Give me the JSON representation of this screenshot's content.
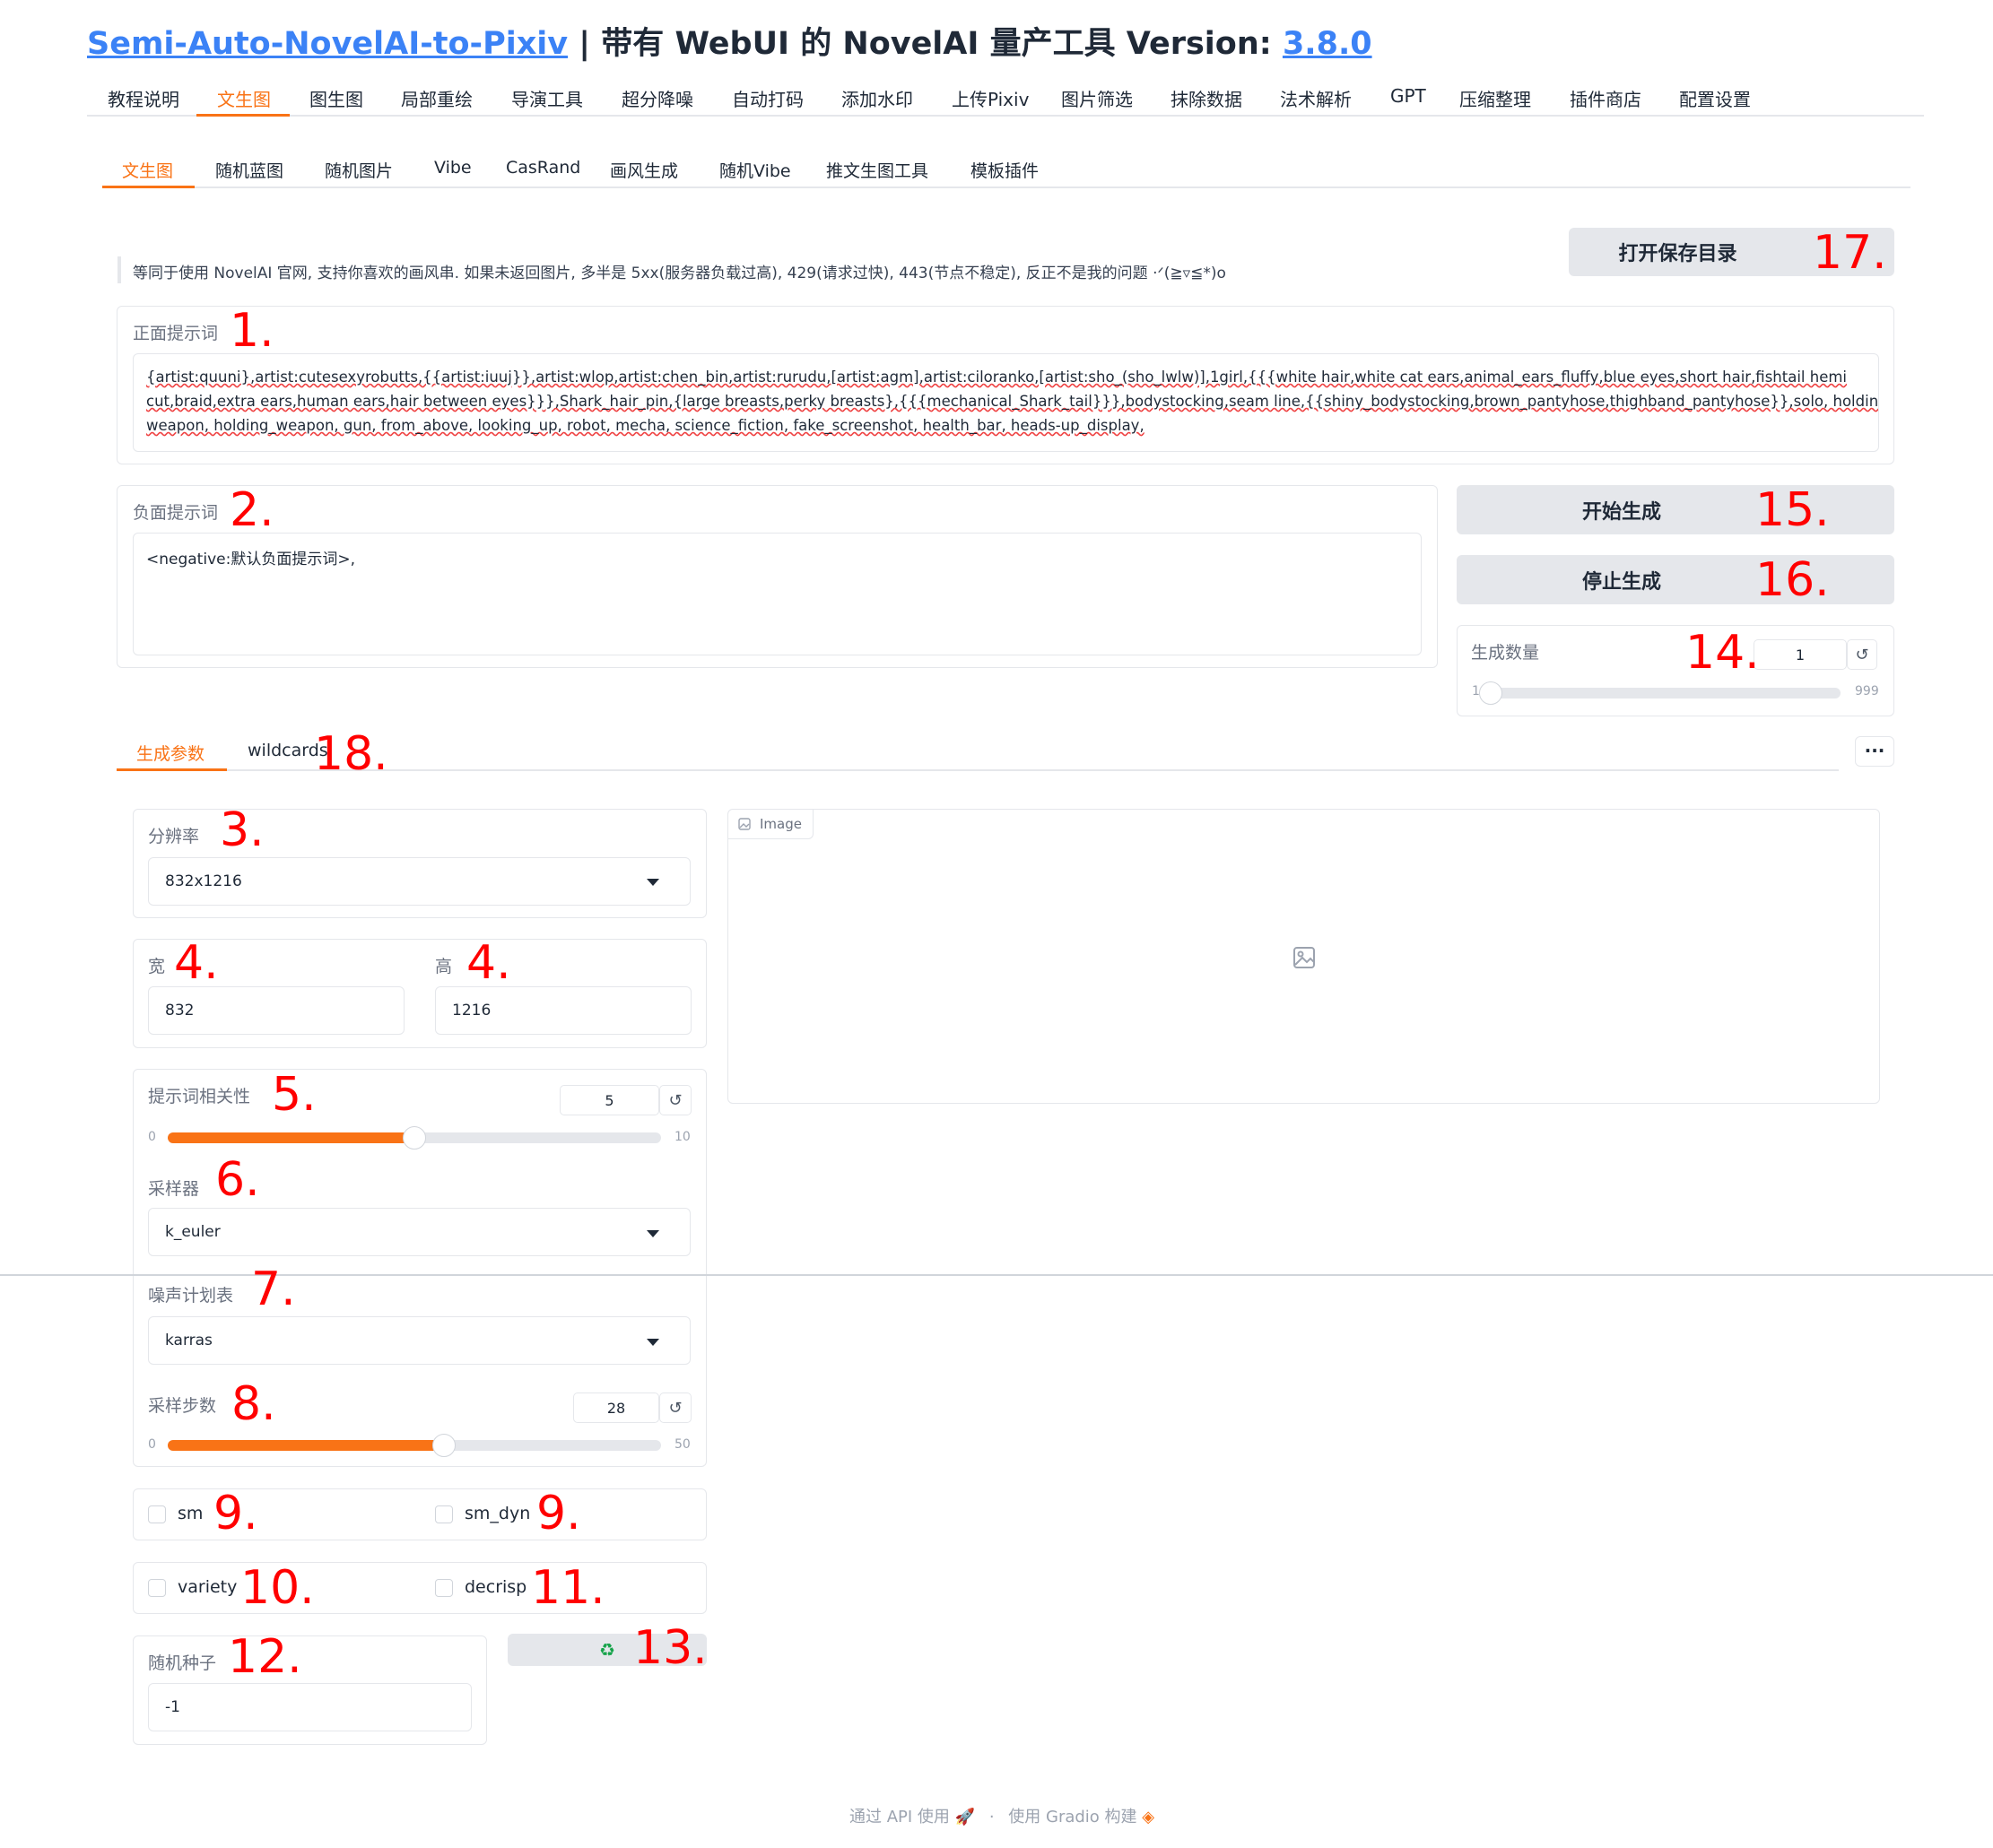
{
  "header": {
    "title_link": "Semi-Auto-NovelAI-to-Pixiv",
    "separator": " | ",
    "subtitle": "带有 WebUI 的 NovelAI 量产工具 Version: ",
    "version": "3.8.0"
  },
  "main_tabs": [
    "教程说明",
    "文生图",
    "图生图",
    "局部重绘",
    "导演工具",
    "超分降噪",
    "自动打码",
    "添加水印",
    "上传Pixiv",
    "图片筛选",
    "抹除数据",
    "法术解析",
    "GPT",
    "压缩整理",
    "插件商店",
    "配置设置"
  ],
  "sub_tabs": [
    "文生图",
    "随机蓝图",
    "随机图片",
    "Vibe",
    "CasRand",
    "画风生成",
    "随机Vibe",
    "推文生图工具",
    "模板插件"
  ],
  "info_text": "等同于使用 NovelAI 官网, 支持你喜欢的画风串. 如果未返回图片, 多半是 5xx(服务器负载过高), 429(请求过快), 443(节点不稳定), 反正不是我的问题 ·ᐟ(≧▿≦*)o",
  "open_folder_button": "打开保存目录",
  "positive": {
    "label": "正面提示词",
    "lines": [
      "{artist:quuni},artist:cutesexyrobutts,{{artist:iuuj}},artist:wlop,artist:chen_bin,artist:rurudu,[artist:agm],artist:ciloranko,[artist:sho_(sho_lwlw)],1girl,{{{white hair,white cat ears,animal_ears_fluffy,blue eyes,short hair,fishtail hemi",
      "cut,braid,extra ears,human ears,hair between eyes}}},Shark_hair_pin,{large breasts,perky breasts},{{{mechanical_Shark_tail}}},bodystocking,seam line,{{shiny_bodystocking,brown_pantyhose,thighband_pantyhose}},solo, holding,",
      "weapon, holding_weapon, gun, from_above, looking_up, robot, mecha, science_fiction, fake_screenshot, health_bar, heads-up_display,"
    ]
  },
  "negative": {
    "label": "负面提示词",
    "value": "<negative:默认负面提示词>,"
  },
  "start_button": "开始生成",
  "stop_button": "停止生成",
  "batch": {
    "label": "生成数量",
    "value": "1",
    "min": "1",
    "max": "999",
    "fraction": 0.0
  },
  "param_tabs": [
    "生成参数",
    "wildcards"
  ],
  "more_button": "···",
  "resolution": {
    "label": "分辨率",
    "value": "832x1216"
  },
  "width": {
    "label": "宽",
    "value": "832"
  },
  "height": {
    "label": "高",
    "value": "1216"
  },
  "cfg": {
    "label": "提示词相关性",
    "value": "5",
    "min": "0",
    "max": "10",
    "fraction": 0.5
  },
  "sampler": {
    "label": "采样器",
    "value": "k_euler"
  },
  "scheduler": {
    "label": "噪声计划表",
    "value": "karras"
  },
  "steps": {
    "label": "采样步数",
    "value": "28",
    "min": "0",
    "max": "50",
    "fraction": 0.56
  },
  "checkboxes": {
    "sm": "sm",
    "sm_dyn": "sm_dyn",
    "variety": "variety",
    "decrisp": "decrisp"
  },
  "seed": {
    "label": "随机种子",
    "value": "-1"
  },
  "recycle_icon": "♻",
  "image_panel": {
    "label": "Image"
  },
  "footer": {
    "api": "通过 API 使用",
    "dot": "·",
    "built": "使用 Gradio 构建"
  },
  "annotations": {
    "a1": "1.",
    "a2": "2.",
    "a3": "3.",
    "a4a": "4.",
    "a4b": "4.",
    "a5": "5.",
    "a6": "6.",
    "a7": "7.",
    "a8": "8.",
    "a9a": "9.",
    "a9b": "9.",
    "a10": "10.",
    "a11": "11.",
    "a12": "12.",
    "a13": "13.",
    "a14": "14.",
    "a15": "15.",
    "a16": "16.",
    "a17": "17.",
    "a18": "18."
  },
  "colors": {
    "accent": "#f97316",
    "link": "#3b82f6",
    "annotation": "#ff0000",
    "button_bg": "#e5e7eb"
  }
}
